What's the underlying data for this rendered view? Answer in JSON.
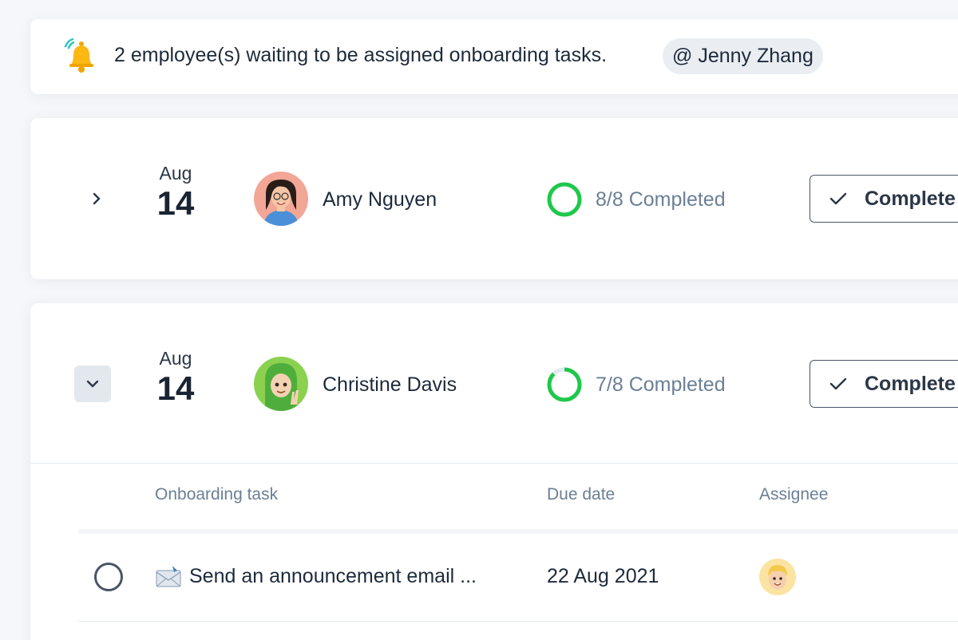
{
  "notification": {
    "icon": "bell-icon",
    "message": "2 employee(s) waiting to be assigned onboarding tasks.",
    "mention": "@ Jenny Zhang"
  },
  "employees": [
    {
      "month": "Aug",
      "day": "14",
      "name": "Amy Nguyen",
      "progress_text": "8/8 Completed",
      "progress_fraction": 1.0,
      "button_label": "Complete",
      "expanded": false
    },
    {
      "month": "Aug",
      "day": "14",
      "name": "Christine Davis",
      "progress_text": "7/8 Completed",
      "progress_fraction": 0.875,
      "button_label": "Complete",
      "expanded": true
    }
  ],
  "task_table": {
    "headers": {
      "task": "Onboarding task",
      "due": "Due date",
      "assignee": "Assignee"
    },
    "rows": [
      {
        "task": "Send an announcement email ...",
        "task_icon": "envelope-icon",
        "due": "22 Aug 2021",
        "completed": false
      }
    ]
  },
  "colors": {
    "progress_green": "#1ec84b",
    "progress_track": "#e2e8ef",
    "text_muted": "#6b7f96",
    "text_dark": "#1e2a3b"
  }
}
